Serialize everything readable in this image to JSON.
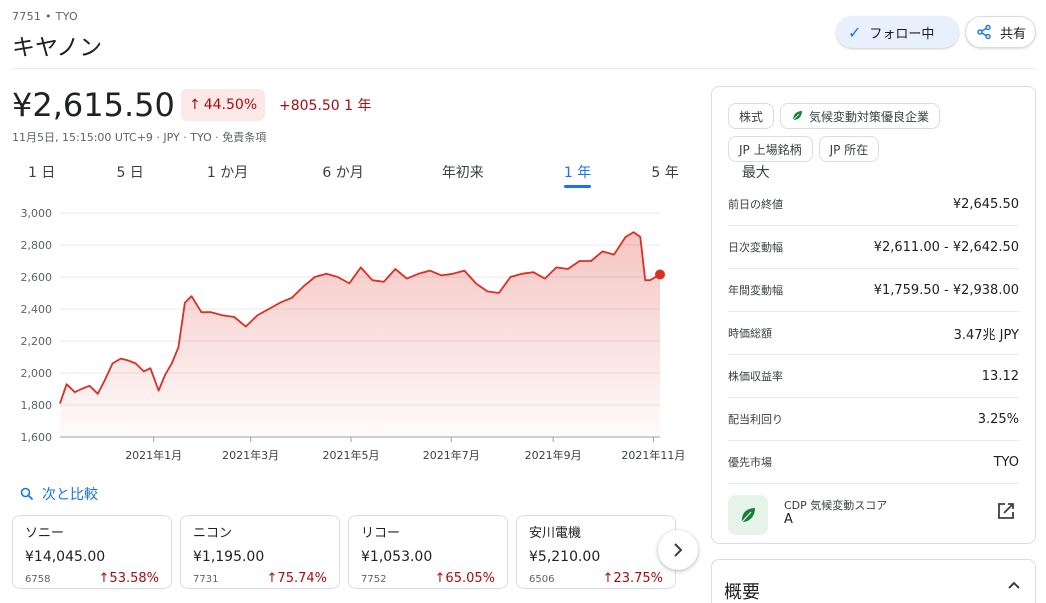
{
  "header": {
    "ticker": "7751 • TYO",
    "company": "キヤノン",
    "follow_label": "フォロー中",
    "share_label": "共有"
  },
  "quote": {
    "price": "¥2,615.50",
    "pct_change": "44.50%",
    "delta": "+805.50 1 年",
    "subinfo": "11月5日, 15:15:00 UTC+9 · JPY · TYO · 免責条項"
  },
  "tabs": [
    {
      "label": "1 日"
    },
    {
      "label": "5 日"
    },
    {
      "label": "1 か月"
    },
    {
      "label": "6 か月"
    },
    {
      "label": "年初来"
    },
    {
      "label": "1 年",
      "active": true
    },
    {
      "label": "5 年"
    },
    {
      "label": "最大"
    }
  ],
  "chart_data": {
    "type": "area",
    "color": "#d93025",
    "ylim": [
      1600,
      3000
    ],
    "yticks": [
      "3,000",
      "2,800",
      "2,600",
      "2,400",
      "2,200",
      "2,000",
      "1,800",
      "1,600"
    ],
    "xticks": [
      "2021年1月",
      "2021年3月",
      "2021年5月",
      "2021年7月",
      "2021年9月",
      "2021年11月"
    ],
    "x": [
      "2020-11-05",
      "2020-11-09",
      "2020-11-14",
      "2020-11-18",
      "2020-11-23",
      "2020-11-28",
      "2020-12-02",
      "2020-12-07",
      "2020-12-12",
      "2020-12-16",
      "2020-12-21",
      "2020-12-26",
      "2020-12-30",
      "2021-01-04",
      "2021-01-08",
      "2021-01-12",
      "2021-01-16",
      "2021-01-20",
      "2021-01-24",
      "2021-01-30",
      "2021-02-05",
      "2021-02-12",
      "2021-02-19",
      "2021-02-26",
      "2021-03-05",
      "2021-03-12",
      "2021-03-19",
      "2021-03-26",
      "2021-04-02",
      "2021-04-09",
      "2021-04-16",
      "2021-04-23",
      "2021-04-30",
      "2021-05-07",
      "2021-05-14",
      "2021-05-21",
      "2021-05-28",
      "2021-06-04",
      "2021-06-11",
      "2021-06-18",
      "2021-06-25",
      "2021-07-02",
      "2021-07-09",
      "2021-07-16",
      "2021-07-23",
      "2021-07-30",
      "2021-08-06",
      "2021-08-13",
      "2021-08-20",
      "2021-08-27",
      "2021-09-03",
      "2021-09-10",
      "2021-09-17",
      "2021-09-24",
      "2021-10-01",
      "2021-10-08",
      "2021-10-15",
      "2021-10-20",
      "2021-10-24",
      "2021-10-27",
      "2021-10-30",
      "2021-11-05"
    ],
    "values": [
      1810,
      1930,
      1880,
      1900,
      1920,
      1870,
      1950,
      2060,
      2090,
      2080,
      2060,
      2010,
      2030,
      1890,
      1990,
      2060,
      2160,
      2440,
      2480,
      2380,
      2380,
      2360,
      2350,
      2290,
      2360,
      2400,
      2440,
      2470,
      2540,
      2600,
      2620,
      2600,
      2560,
      2660,
      2580,
      2570,
      2650,
      2590,
      2620,
      2640,
      2610,
      2620,
      2640,
      2560,
      2510,
      2500,
      2600,
      2620,
      2630,
      2590,
      2660,
      2650,
      2700,
      2700,
      2760,
      2740,
      2850,
      2880,
      2850,
      2580,
      2580,
      2615.5
    ]
  },
  "compare": {
    "label": "次と比較",
    "cards": [
      {
        "name": "ソニー",
        "price": "¥14,045.00",
        "code": "6758",
        "change": "53.58%"
      },
      {
        "name": "ニコン",
        "price": "¥1,195.00",
        "code": "7731",
        "change": "75.74%"
      },
      {
        "name": "リコー",
        "price": "¥1,053.00",
        "code": "7752",
        "change": "65.05%"
      },
      {
        "name": "安川電機",
        "price": "¥5,210.00",
        "code": "6506",
        "change": "23.75%"
      }
    ]
  },
  "panel": {
    "chips": [
      {
        "label": "株式"
      },
      {
        "label": "気候変動対策優良企業",
        "leaf": true
      },
      {
        "label": "JP 上場銘柄"
      },
      {
        "label": "JP 所在"
      }
    ],
    "stats": [
      {
        "k": "前日の終値",
        "v": "¥2,645.50"
      },
      {
        "k": "日次変動幅",
        "v": "¥2,611.00 - ¥2,642.50"
      },
      {
        "k": "年間変動幅",
        "v": "¥1,759.50 - ¥2,938.00"
      },
      {
        "k": "時価総額",
        "v": "3.47兆 JPY"
      },
      {
        "k": "株価収益率",
        "v": "13.12"
      },
      {
        "k": "配当利回り",
        "v": "3.25%"
      },
      {
        "k": "優先市場",
        "v": "TYO"
      }
    ],
    "cdp_label": "CDP 気候変動スコア",
    "cdp_grade": "A"
  },
  "overview": {
    "title": "概要"
  }
}
